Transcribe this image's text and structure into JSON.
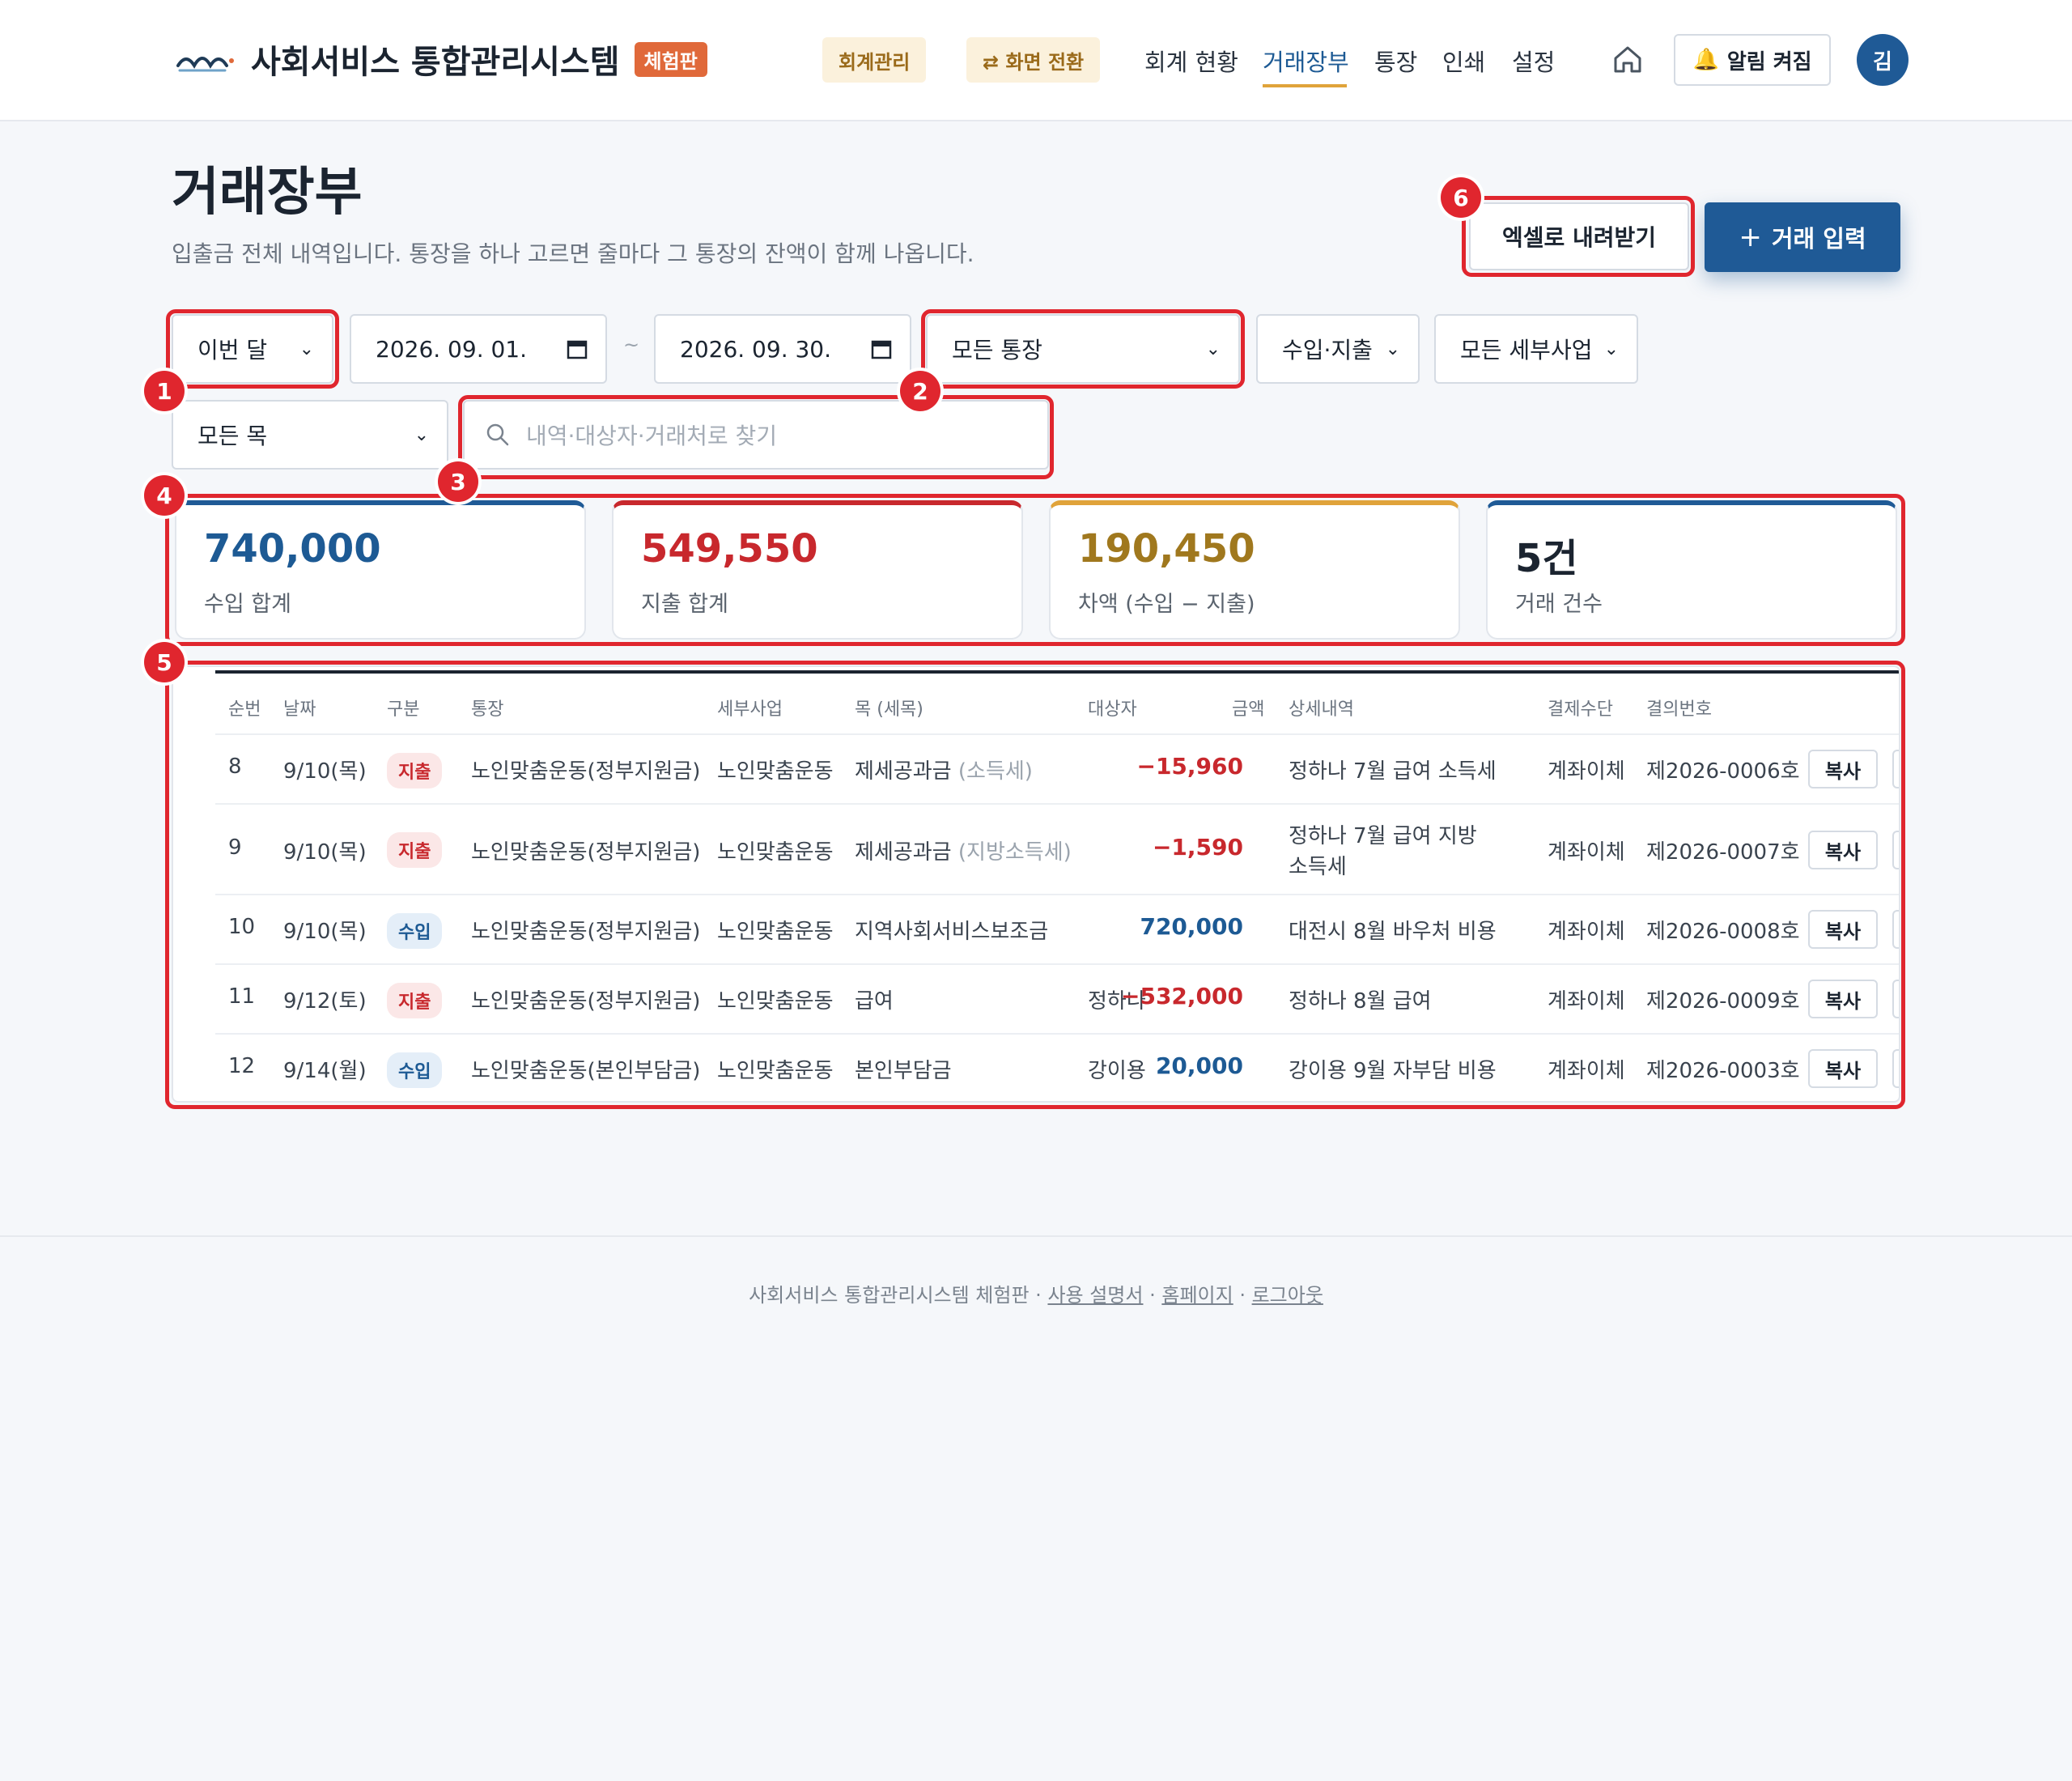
{
  "header": {
    "app_name": "사회서비스 통합관리시스템",
    "badge": "체험판",
    "pill_accounting": "회계관리",
    "pill_switch": "⇄ 화면 전환",
    "nav": [
      "회계 현황",
      "거래장부",
      "통장",
      "인쇄",
      "설정"
    ],
    "active_nav": "거래장부",
    "alarm_label": "알림 켜짐",
    "avatar_initial": "김"
  },
  "page": {
    "title": "거래장부",
    "description": "입출금 전체 내역입니다. 통장을 하나 고르면 줄마다 그 통장의 잔액이 함께 나옵니다.",
    "excel_button": "엑셀로 내려받기",
    "add_button": "거래 입력"
  },
  "filters": {
    "period": "이번 달",
    "date_from": "2026. 09. 01.",
    "date_to": "2026. 09. 30.",
    "tilde": "~",
    "account": "모든 통장",
    "io_type": "수입·지출",
    "sub_project": "모든 세부사업",
    "item": "모든 목",
    "search_placeholder": "내역·대상자·거래처로 찾기"
  },
  "summary": [
    {
      "value": "740,000",
      "label": "수입 합계",
      "color": "#1d5a94"
    },
    {
      "value": "549,550",
      "label": "지출 합계",
      "color": "#c8282d"
    },
    {
      "value": "190,450",
      "label": "차액 (수입 − 지출)",
      "color": "#a0781e"
    },
    {
      "value": "5건",
      "label": "거래 건수",
      "color": "#1b2430"
    }
  ],
  "table": {
    "headers": [
      "순번",
      "날짜",
      "구분",
      "통장",
      "세부사업",
      "목 (세목)",
      "대상자",
      "금액",
      "상세내역",
      "결제수단",
      "결의번호"
    ],
    "copy_label": "복사",
    "rows": [
      {
        "no": "8",
        "date": "9/10(목)",
        "type": "지출",
        "account": "노인맞춤운동(정부지원금)",
        "project": "노인맞춤운동",
        "item": "제세공과금",
        "subitem": "(소득세)",
        "target": "",
        "amount": "−15,960",
        "detail1": "정하나 7월 급여 소득세",
        "detail2": "",
        "method": "계좌이체",
        "voucher": "제2026-0006호"
      },
      {
        "no": "9",
        "date": "9/10(목)",
        "type": "지출",
        "account": "노인맞춤운동(정부지원금)",
        "project": "노인맞춤운동",
        "item": "제세공과금",
        "subitem": "(지방소득세)",
        "target": "",
        "amount": "−1,590",
        "detail1": "정하나 7월 급여 지방",
        "detail2": "소득세",
        "method": "계좌이체",
        "voucher": "제2026-0007호"
      },
      {
        "no": "10",
        "date": "9/10(목)",
        "type": "수입",
        "account": "노인맞춤운동(정부지원금)",
        "project": "노인맞춤운동",
        "item": "지역사회서비스보조금",
        "subitem": "",
        "target": "",
        "amount": "720,000",
        "detail1": "대전시 8월 바우처 비용",
        "detail2": "",
        "method": "계좌이체",
        "voucher": "제2026-0008호"
      },
      {
        "no": "11",
        "date": "9/12(토)",
        "type": "지출",
        "account": "노인맞춤운동(정부지원금)",
        "project": "노인맞춤운동",
        "item": "급여",
        "subitem": "",
        "target": "정하나",
        "amount": "−532,000",
        "detail1": "정하나 8월 급여",
        "detail2": "",
        "method": "계좌이체",
        "voucher": "제2026-0009호"
      },
      {
        "no": "12",
        "date": "9/14(월)",
        "type": "수입",
        "account": "노인맞춤운동(본인부담금)",
        "project": "노인맞춤운동",
        "item": "본인부담금",
        "subitem": "",
        "target": "강이용",
        "amount": "20,000",
        "detail1": "강이용 9월 자부담 비용",
        "detail2": "",
        "method": "계좌이체",
        "voucher": "제2026-0003호"
      }
    ]
  },
  "annotations": [
    "1",
    "2",
    "3",
    "4",
    "5",
    "6"
  ],
  "footer": {
    "text": "사회서비스 통합관리시스템 체험판 · ",
    "links": [
      "사용 설명서",
      "홈페이지",
      "로그아웃"
    ],
    "sep": " · "
  }
}
